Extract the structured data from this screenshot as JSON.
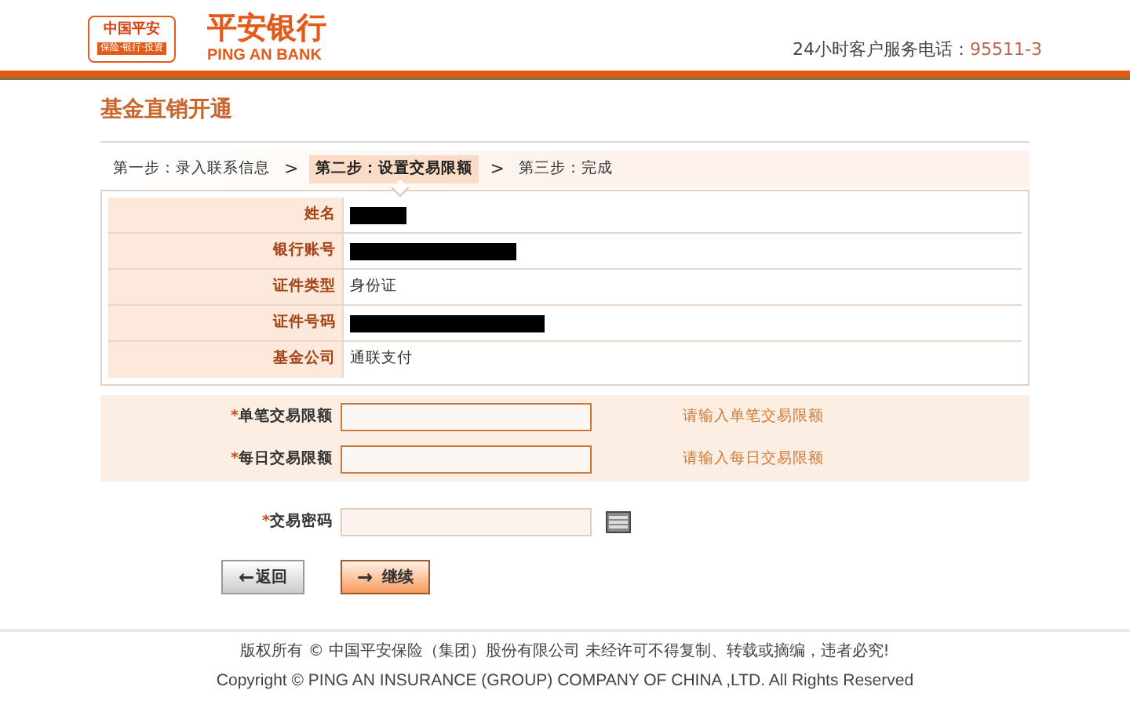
{
  "header": {
    "logo_badge": "中国平安",
    "logo_tagline": "保险·银行·投资",
    "brand_cn": "平安银行",
    "brand_en": "PING AN BANK",
    "hotline_label": "24小时客户服务电话：",
    "hotline_number": "95511-3"
  },
  "page_title": "基金直销开通",
  "steps": [
    {
      "kind": "step",
      "label": "第一步：录入联系信息",
      "selected": false
    },
    {
      "kind": "separator",
      "label": ">"
    },
    {
      "kind": "step",
      "label": "第二步：设置交易限额",
      "selected": true
    },
    {
      "kind": "separator",
      "label": ">"
    },
    {
      "kind": "step",
      "label": "第三步：完成",
      "selected": false
    }
  ],
  "info_rows": [
    {
      "label": "姓名",
      "kind": "redacted"
    },
    {
      "label": "银行账号",
      "kind": "redacted"
    },
    {
      "label": "证件类型",
      "kind": "text",
      "value": "身份证"
    },
    {
      "label": "证件号码",
      "kind": "redacted"
    },
    {
      "label": "基金公司",
      "kind": "text",
      "value": "通联支付"
    }
  ],
  "limit_fields": [
    {
      "required_mark": "*",
      "label": "单笔交易限额",
      "hint": "请输入单笔交易限额"
    },
    {
      "required_mark": "*",
      "label": "每日交易限额",
      "hint": "请输入每日交易限额"
    }
  ],
  "password_field": {
    "required_mark": "*",
    "label": "交易密码"
  },
  "buttons": [
    {
      "kind": "back",
      "icon": "←",
      "label": "返回"
    },
    {
      "kind": "next",
      "icon": "→",
      "label": "继续"
    }
  ],
  "footer": {
    "line_cn": "版权所有 © 中国平安保险（集团）股份有限公司 未经许可不得复制、转载或摘编，违者必究!",
    "line_en": "Copyright © PING AN INSURANCE (GROUP) COMPANY OF CHINA ,LTD. All Rights Reserved"
  }
}
